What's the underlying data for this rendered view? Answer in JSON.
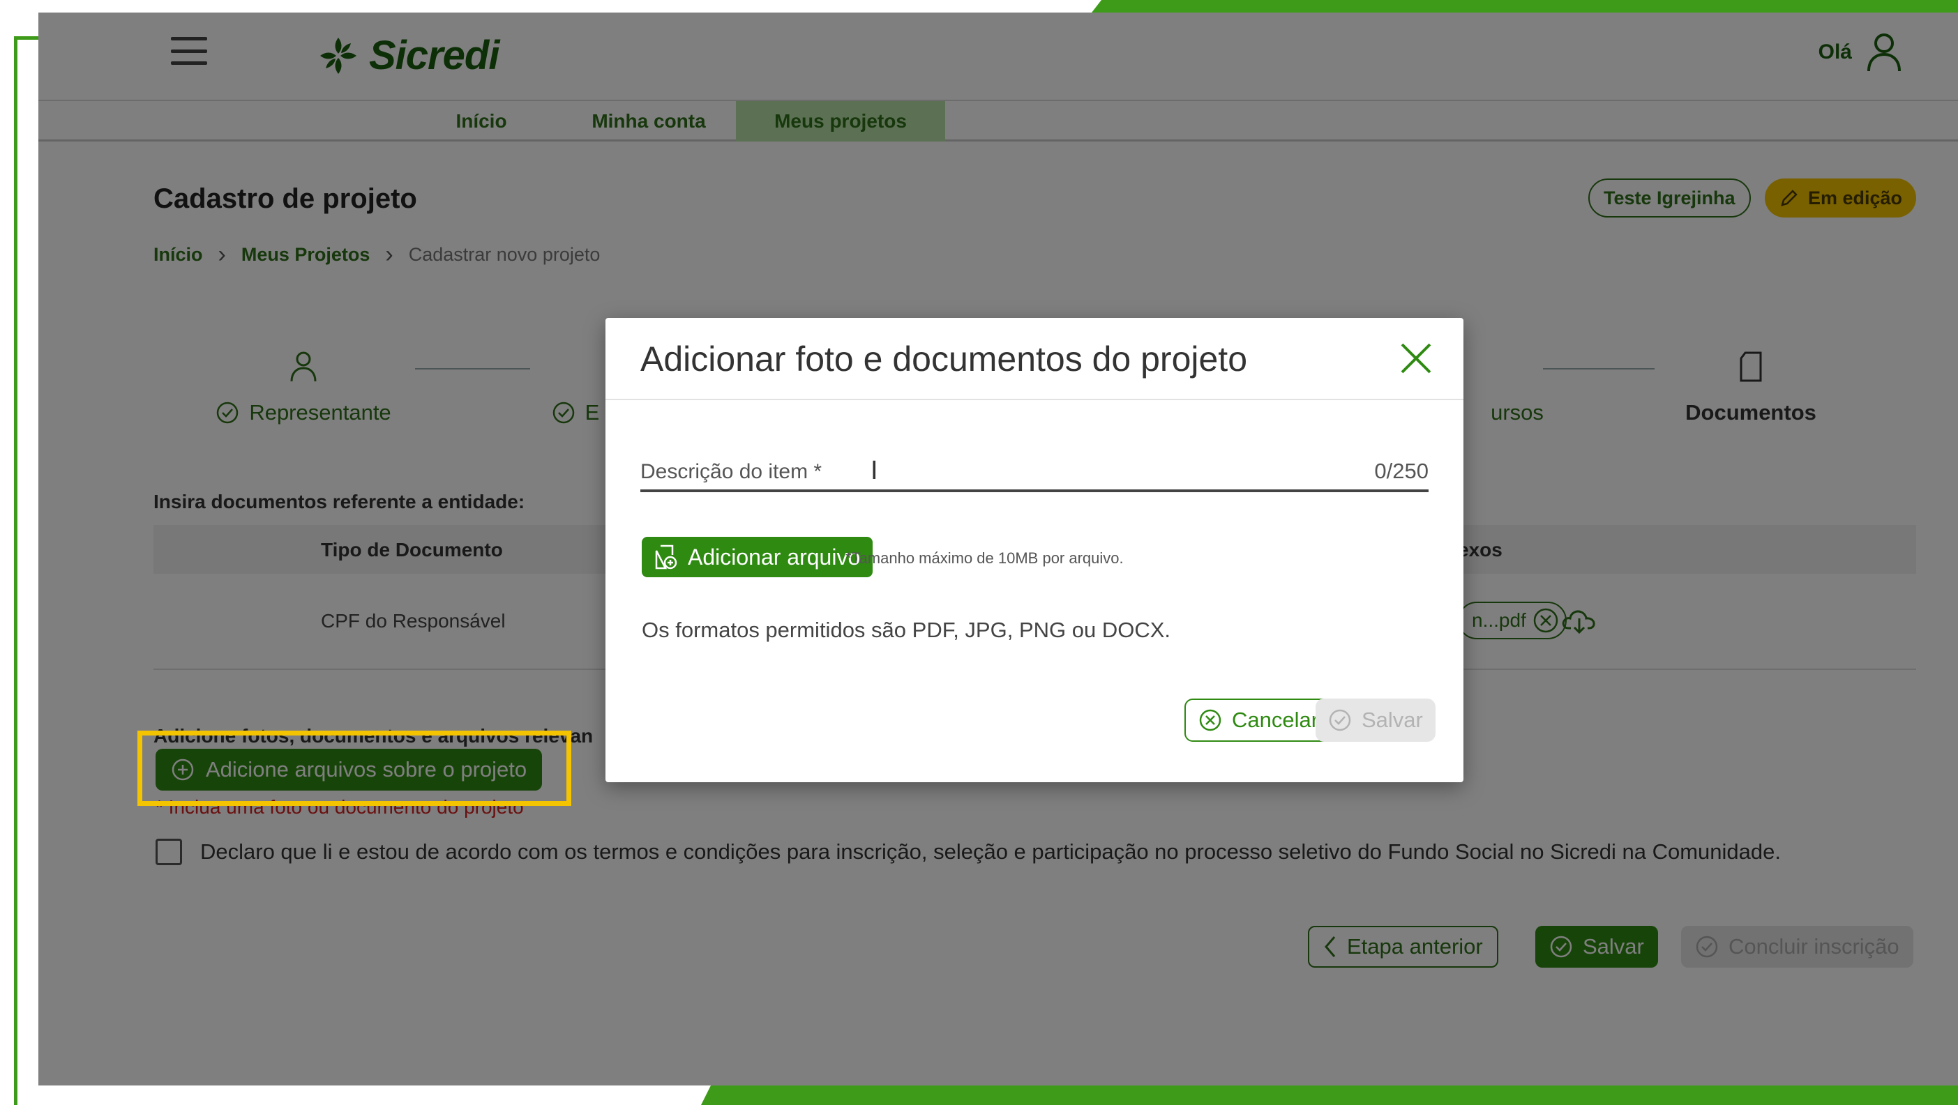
{
  "app": {
    "logo_text": "Sicredi",
    "greeting": "Olá"
  },
  "nav": {
    "tabs": [
      {
        "label": "Início"
      },
      {
        "label": "Minha conta"
      },
      {
        "label": "Meus projetos"
      }
    ]
  },
  "page": {
    "title": "Cadastro de projeto",
    "project_badge": "Teste Igrejinha",
    "status_badge": "Em edição"
  },
  "breadcrumb": {
    "items": [
      "Início",
      "Meus Projetos",
      "Cadastrar novo projeto"
    ]
  },
  "stepper": {
    "steps": [
      {
        "label": "Representante"
      },
      {
        "label": "E"
      },
      {
        "label": "ursos"
      },
      {
        "label": "Documentos"
      }
    ]
  },
  "documents": {
    "section_label": "Insira documentos referente a entidade:",
    "columns": [
      "Tipo de Documento",
      "exos"
    ],
    "rows": [
      {
        "type": "CPF do Responsável",
        "file": "n...pdf"
      }
    ]
  },
  "project_files": {
    "section_label": "Adicione fotos, documentos e arquivos relevan",
    "add_button": "Adicione arquivos sobre o projeto",
    "required_hint": "* Inclua uma foto ou documento do projeto"
  },
  "terms": {
    "text": "Declaro que li e estou de acordo com os termos e condições para inscrição, seleção e participação no processo seletivo do Fundo Social no Sicredi na Comunidade."
  },
  "footer": {
    "prev_label": "Etapa anterior",
    "save_label": "Salvar",
    "conclude_label": "Concluir inscrição"
  },
  "modal": {
    "title": "Adicionar foto e documentos do projeto",
    "field_label": "Descrição do item *",
    "field_counter": "0/250",
    "add_file_label": "Adicionar arquivo",
    "size_note": "*Tamanho máximo de 10MB por arquivo.",
    "formats_note": "Os formatos permitidos são PDF, JPG, PNG ou DOCX.",
    "cancel_label": "Cancelar",
    "save_label": "Salvar"
  },
  "colors": {
    "brand_green": "#2f8a12",
    "dark_green": "#1a5e0e",
    "frame_green": "#3e9b1a",
    "highlight_yellow": "#f5c400",
    "status_yellow": "#f2c300"
  }
}
